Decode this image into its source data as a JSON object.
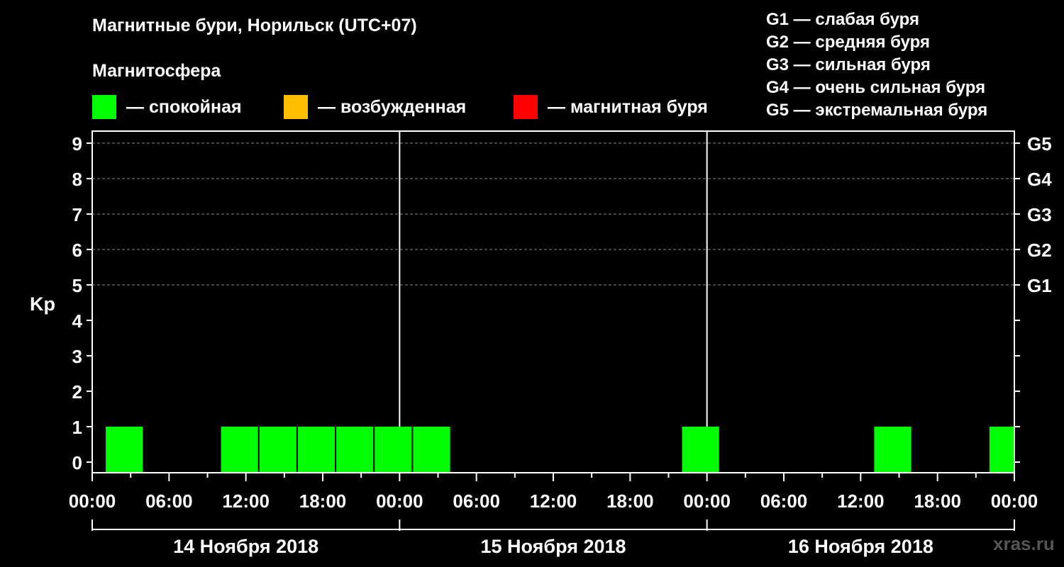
{
  "title": "Магнитные бури, Норильск (UTC+07)",
  "legend": {
    "heading": "Магнитосфера",
    "items": [
      {
        "label": "— спокойная",
        "color": "#00ff00"
      },
      {
        "label": "— возбужденная",
        "color": "#ffbf00"
      },
      {
        "label": "— магнитная буря",
        "color": "#ff0000"
      }
    ]
  },
  "g_scale": [
    "G1 — слабая буря",
    "G2 — средняя буря",
    "G3 — сильная буря",
    "G4 — очень сильная буря",
    "G5 — экстремальная буря"
  ],
  "watermark": "xras.ru",
  "chart_data": {
    "type": "bar",
    "title": "Магнитные бури, Норильск (UTC+07)",
    "ylabel": "Kp",
    "ylim": [
      0,
      9
    ],
    "yticks": [
      "0",
      "1",
      "2",
      "3",
      "4",
      "5",
      "6",
      "7",
      "8",
      "9"
    ],
    "right_axis_labels": [
      {
        "kp": 5,
        "label": "G1"
      },
      {
        "kp": 6,
        "label": "G2"
      },
      {
        "kp": 7,
        "label": "G3"
      },
      {
        "kp": 8,
        "label": "G4"
      },
      {
        "kp": 9,
        "label": "G5"
      }
    ],
    "xlim_hours": [
      0,
      72
    ],
    "x_tick_labels": [
      "00:00",
      "06:00",
      "12:00",
      "18:00",
      "00:00",
      "06:00",
      "12:00",
      "18:00",
      "00:00",
      "06:00",
      "12:00",
      "18:00",
      "00:00"
    ],
    "dates": [
      "14 Ноября 2018",
      "15 Ноября 2018",
      "16 Ноября 2018"
    ],
    "grid": "dashed horizontal at Kp 5–9",
    "series": [
      {
        "values": [
          {
            "start_hour": 1,
            "value": 1,
            "status": "спокойная"
          },
          {
            "start_hour": 10,
            "value": 1,
            "status": "спокойная"
          },
          {
            "start_hour": 13,
            "value": 1,
            "status": "спокойная"
          },
          {
            "start_hour": 16,
            "value": 1,
            "status": "спокойная"
          },
          {
            "start_hour": 19,
            "value": 1,
            "status": "спокойная"
          },
          {
            "start_hour": 22,
            "value": 1,
            "status": "спокойная"
          },
          {
            "start_hour": 25,
            "value": 1,
            "status": "спокойная"
          },
          {
            "start_hour": 46,
            "value": 1,
            "status": "спокойная"
          },
          {
            "start_hour": 61,
            "value": 1,
            "status": "спокойная"
          },
          {
            "start_hour": 70,
            "value": 1,
            "status": "спокойная"
          }
        ]
      }
    ]
  }
}
